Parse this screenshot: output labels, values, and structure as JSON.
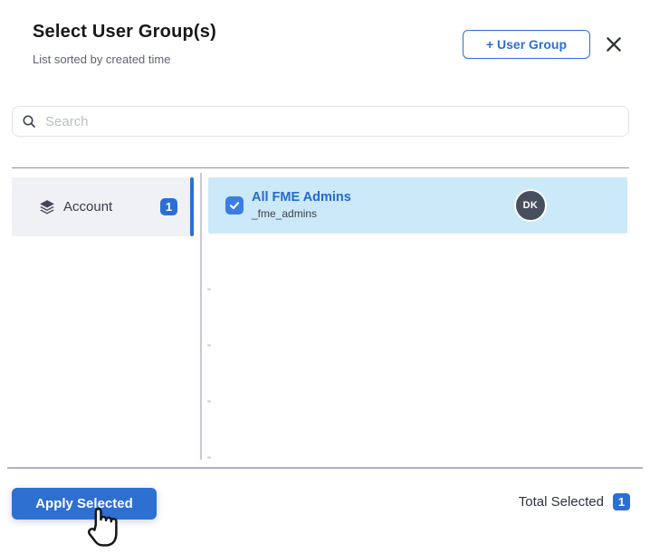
{
  "header": {
    "title": "Select User Group(s)",
    "subtitle": "List sorted by created time",
    "add_button_label": "+ User Group"
  },
  "search": {
    "placeholder": "Search",
    "value": ""
  },
  "sidebar": {
    "items": [
      {
        "label": "Account",
        "count": "1",
        "icon": "layers-icon",
        "active": true
      }
    ]
  },
  "list": {
    "items": [
      {
        "name": "All FME Admins",
        "id": "_fme_admins",
        "avatar_initials": "DK",
        "selected": true
      }
    ]
  },
  "footer": {
    "apply_label": "Apply Selected",
    "total_label": "Total Selected",
    "total_count": "1"
  },
  "colors": {
    "accent": "#2b6fd4",
    "selection_background": "#cbe9f8",
    "sidebar_background": "#f0f1f4",
    "avatar_background": "#474e5d",
    "link_blue": "#2569d3"
  }
}
